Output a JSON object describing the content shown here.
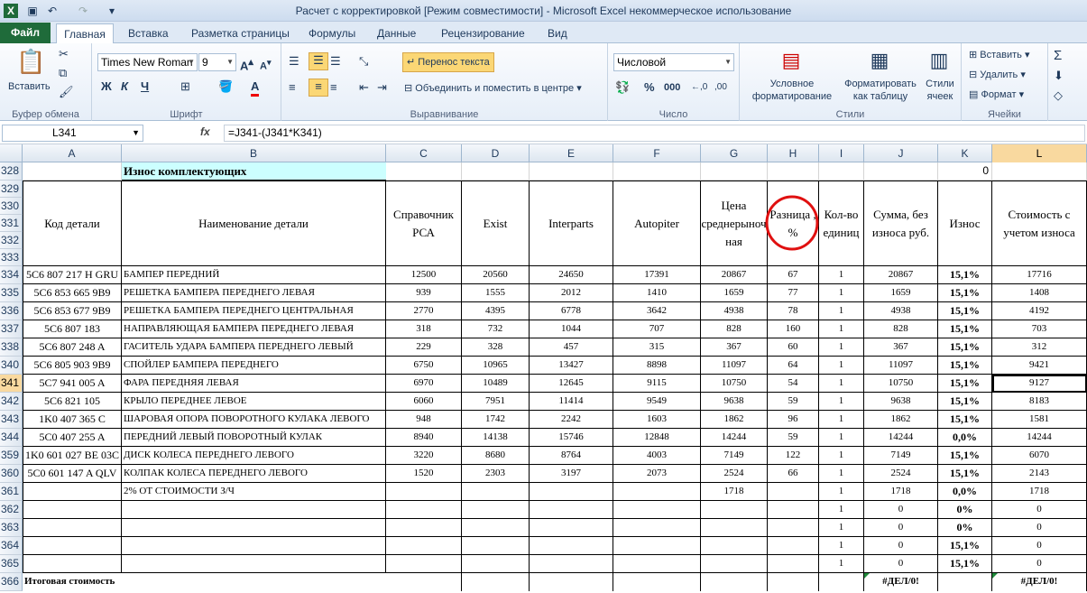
{
  "window": {
    "title": "Расчет с корректировкой  [Режим совместимости]  -  Microsoft Excel некоммерческое использование"
  },
  "tabs": {
    "file": "Файл",
    "home": "Главная",
    "insert": "Вставка",
    "layout": "Разметка страницы",
    "formulas": "Формулы",
    "data": "Данные",
    "review": "Рецензирование",
    "view": "Вид"
  },
  "ribbon": {
    "clipboard": {
      "label": "Буфер обмена",
      "paste": "Вставить"
    },
    "font": {
      "label": "Шрифт",
      "name": "Times New Roman",
      "size": "9"
    },
    "alignment": {
      "label": "Выравнивание",
      "wrap": "Перенос текста",
      "merge": "Объединить и поместить в центре"
    },
    "number": {
      "label": "Число",
      "format": "Числовой"
    },
    "styles": {
      "label": "Стили",
      "cond1": "Условное",
      "cond2": "форматирование",
      "table1": "Форматировать",
      "table2": "как таблицу",
      "cell1": "Стили",
      "cell2": "ячеек"
    },
    "cells": {
      "label": "Ячейки",
      "insert": "Вставить",
      "delete": "Удалить",
      "format": "Формат"
    }
  },
  "formula_bar": {
    "name_box": "L341",
    "fx": "fx",
    "formula": "=J341-(J341*K341)"
  },
  "columns": [
    "A",
    "B",
    "C",
    "D",
    "E",
    "F",
    "G",
    "H",
    "I",
    "J",
    "K",
    "L"
  ],
  "sheet": {
    "row328": {
      "num": "328",
      "title": "Износ комплектующих",
      "k": "0"
    },
    "header_rows": [
      "329",
      "330",
      "331",
      "332",
      "333"
    ],
    "headers": {
      "a": "Код детали",
      "b": "Наименование детали",
      "c": "Справочник РСА",
      "d": "Exist",
      "e": "Interparts",
      "f": "Autopiter",
      "g": "Цена среднерыночная",
      "h": "Разница , %",
      "i": "Кол-во единиц",
      "j": "Сумма, без износа руб.",
      "k": "Износ",
      "l": "Стоимость с учетом износа"
    },
    "rows": [
      {
        "num": "334",
        "a": "5С6 807 217 H GRU",
        "b": "БАМПЕР ПЕРЕДНИЙ",
        "c": "12500",
        "d": "20560",
        "e": "24650",
        "f": "17391",
        "g": "20867",
        "h": "67",
        "i": "1",
        "j": "20867",
        "k": "15,1%",
        "l": "17716"
      },
      {
        "num": "335",
        "a": "5C6 853 665 9B9",
        "b": "РЕШЕТКА БАМПЕРА ПЕРЕДНЕГО ЛЕВАЯ",
        "c": "939",
        "d": "1555",
        "e": "2012",
        "f": "1410",
        "g": "1659",
        "h": "77",
        "i": "1",
        "j": "1659",
        "k": "15,1%",
        "l": "1408"
      },
      {
        "num": "336",
        "a": "5C6 853 677 9B9",
        "b": "РЕШЕТКА БАМПЕРА ПЕРЕДНЕГО ЦЕНТРАЛЬНАЯ",
        "c": "2770",
        "d": "4395",
        "e": "6778",
        "f": "3642",
        "g": "4938",
        "h": "78",
        "i": "1",
        "j": "4938",
        "k": "15,1%",
        "l": "4192"
      },
      {
        "num": "337",
        "a": "5C6 807 183",
        "b": "НАПРАВЛЯЮЩАЯ БАМПЕРА ПЕРЕДНЕГО ЛЕВАЯ",
        "c": "318",
        "d": "732",
        "e": "1044",
        "f": "707",
        "g": "828",
        "h": "160",
        "i": "1",
        "j": "828",
        "k": "15,1%",
        "l": "703"
      },
      {
        "num": "338",
        "a": "5C6 807 248 A",
        "b": "ГАСИТЕЛЬ УДАРА БАМПЕРА ПЕРЕДНЕГО ЛЕВЫЙ",
        "c": "229",
        "d": "328",
        "e": "457",
        "f": "315",
        "g": "367",
        "h": "60",
        "i": "1",
        "j": "367",
        "k": "15,1%",
        "l": "312"
      },
      {
        "num": "340",
        "a": "5C6 805 903 9B9",
        "b": "СПОЙЛЕР БАМПЕРА ПЕРЕДНЕГО",
        "c": "6750",
        "d": "10965",
        "e": "13427",
        "f": "8898",
        "g": "11097",
        "h": "64",
        "i": "1",
        "j": "11097",
        "k": "15,1%",
        "l": "9421"
      },
      {
        "num": "341",
        "a": "5C7 941 005 A",
        "b": "ФАРА ПЕРЕДНЯЯ ЛЕВАЯ",
        "c": "6970",
        "d": "10489",
        "e": "12645",
        "f": "9115",
        "g": "10750",
        "h": "54",
        "i": "1",
        "j": "10750",
        "k": "15,1%",
        "l": "9127"
      },
      {
        "num": "342",
        "a": "5C6 821 105",
        "b": "КРЫЛО ПЕРЕДНЕЕ ЛЕВОЕ",
        "c": "6060",
        "d": "7951",
        "e": "11414",
        "f": "9549",
        "g": "9638",
        "h": "59",
        "i": "1",
        "j": "9638",
        "k": "15,1%",
        "l": "8183"
      },
      {
        "num": "343",
        "a": "1K0 407 365 C",
        "b": "ШАРОВАЯ ОПОРА ПОВОРОТНОГО КУЛАКА ЛЕВОГО",
        "c": "948",
        "d": "1742",
        "e": "2242",
        "f": "1603",
        "g": "1862",
        "h": "96",
        "i": "1",
        "j": "1862",
        "k": "15,1%",
        "l": "1581"
      },
      {
        "num": "344",
        "a": "5C0 407 255 A",
        "b": "ПЕРЕДНИЙ ЛЕВЫЙ ПОВОРОТНЫЙ КУЛАК",
        "c": "8940",
        "d": "14138",
        "e": "15746",
        "f": "12848",
        "g": "14244",
        "h": "59",
        "i": "1",
        "j": "14244",
        "k": "0,0%",
        "l": "14244"
      },
      {
        "num": "359",
        "a": "1K0 601 027 BE 03C",
        "b": "ДИСК КОЛЕСА ПЕРЕДНЕГО ЛЕВОГО",
        "c": "3220",
        "d": "8680",
        "e": "8764",
        "f": "4003",
        "g": "7149",
        "h": "122",
        "i": "1",
        "j": "7149",
        "k": "15,1%",
        "l": "6070"
      },
      {
        "num": "360",
        "a": "5C0 601 147 A QLV",
        "b": "КОЛПАК КОЛЕСА ПЕРЕДНЕГО ЛЕВОГО",
        "c": "1520",
        "d": "2303",
        "e": "3197",
        "f": "2073",
        "g": "2524",
        "h": "66",
        "i": "1",
        "j": "2524",
        "k": "15,1%",
        "l": "2143"
      },
      {
        "num": "361",
        "a": "",
        "b": "2% ОТ СТОИМОСТИ З/Ч",
        "c": "",
        "d": "",
        "e": "",
        "f": "",
        "g": "1718",
        "h": "",
        "i": "1",
        "j": "1718",
        "k": "0,0%",
        "l": "1718"
      },
      {
        "num": "362",
        "a": "",
        "b": "",
        "c": "",
        "d": "",
        "e": "",
        "f": "",
        "g": "",
        "h": "",
        "i": "1",
        "j": "0",
        "k": "0%",
        "l": "0"
      },
      {
        "num": "363",
        "a": "",
        "b": "",
        "c": "",
        "d": "",
        "e": "",
        "f": "",
        "g": "",
        "h": "",
        "i": "1",
        "j": "0",
        "k": "0%",
        "l": "0"
      },
      {
        "num": "364",
        "a": "",
        "b": "",
        "c": "",
        "d": "",
        "e": "",
        "f": "",
        "g": "",
        "h": "",
        "i": "1",
        "j": "0",
        "k": "15,1%",
        "l": "0"
      },
      {
        "num": "365",
        "a": "",
        "b": "",
        "c": "",
        "d": "",
        "e": "",
        "f": "",
        "g": "",
        "h": "",
        "i": "1",
        "j": "0",
        "k": "15,1%",
        "l": "0"
      }
    ],
    "total": {
      "num": "366",
      "label": "Итоговая стоимость",
      "j": "#ДЕЛ/0!",
      "l": "#ДЕЛ/0!"
    }
  }
}
